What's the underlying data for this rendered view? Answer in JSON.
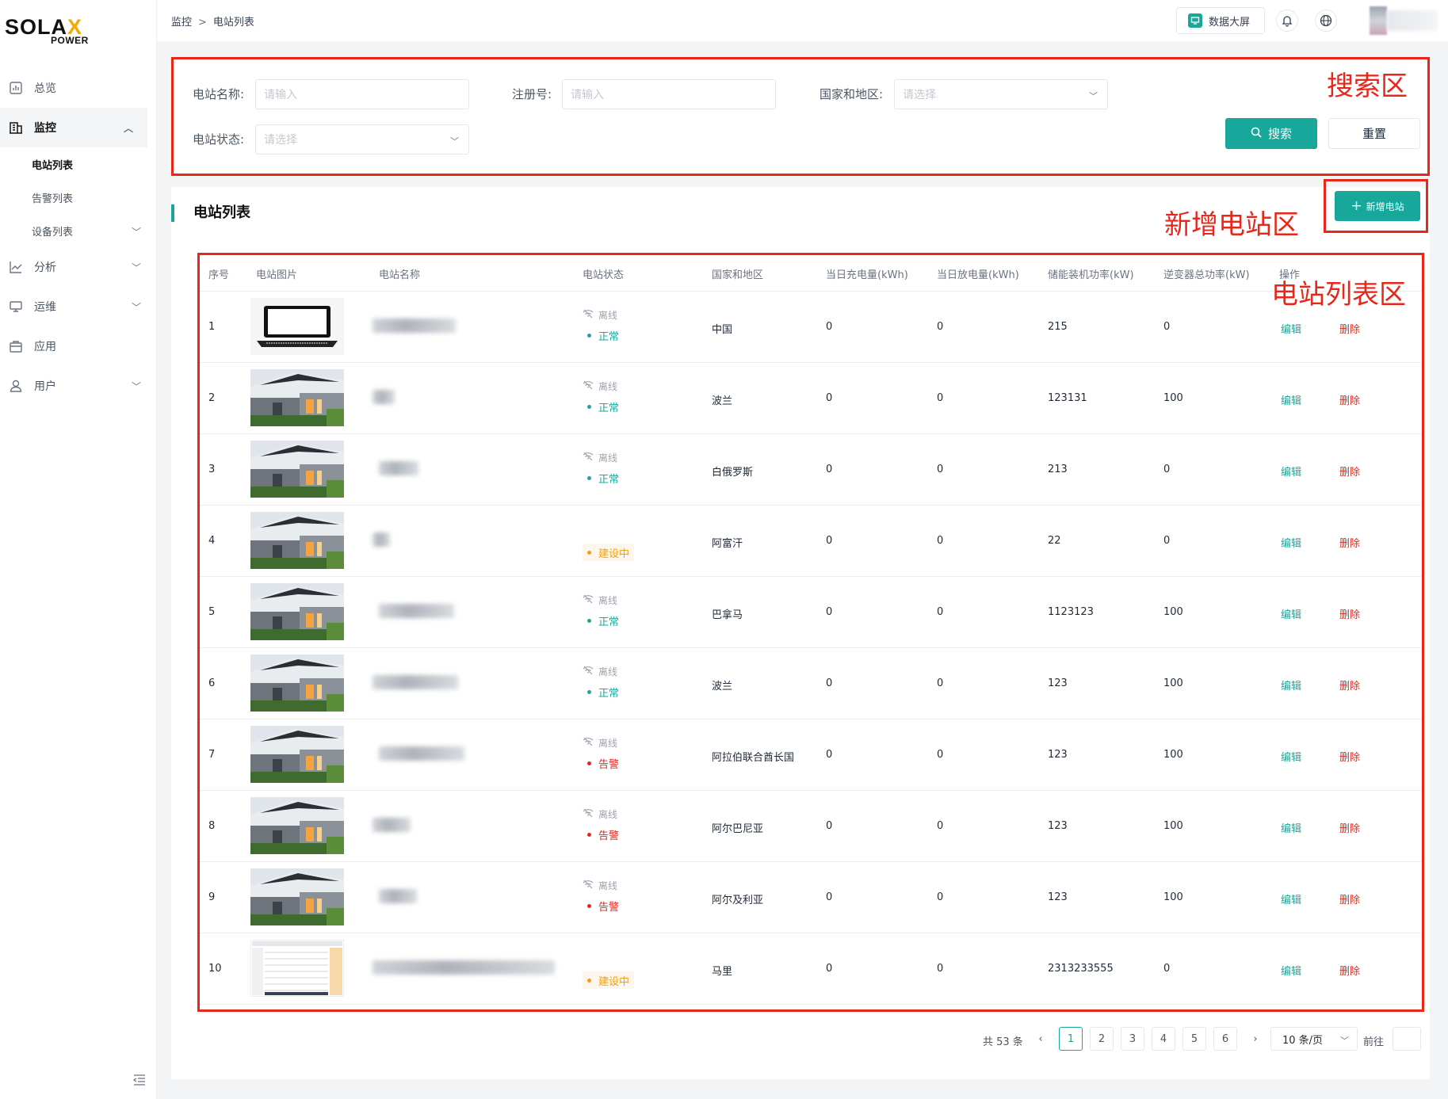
{
  "sidebar": {
    "logo_main": "SOLA",
    "logo_x": "X",
    "logo_sub": "POWER",
    "items": [
      {
        "label": "总览"
      },
      {
        "label": "监控"
      },
      {
        "label": "电站列表"
      },
      {
        "label": "告警列表"
      },
      {
        "label": "设备列表"
      },
      {
        "label": "分析"
      },
      {
        "label": "运维"
      },
      {
        "label": "应用"
      },
      {
        "label": "用户"
      }
    ]
  },
  "header": {
    "breadcrumb": [
      "监控",
      "电站列表"
    ],
    "breadcrumb_sep": ">",
    "bigscreen_label": "数据大屏"
  },
  "search": {
    "station_name_label": "电站名称:",
    "station_name_placeholder": "请输入",
    "reg_no_label": "注册号:",
    "reg_no_placeholder": "请输入",
    "country_label": "国家和地区:",
    "country_placeholder": "请选择",
    "status_label": "电站状态:",
    "status_placeholder": "请选择",
    "search_btn": "搜索",
    "reset_btn": "重置"
  },
  "annotations": {
    "search_zone": "搜索区",
    "add_zone": "新增电站区",
    "list_zone": "电站列表区"
  },
  "list": {
    "title": "电站列表",
    "add_btn": "新增电站",
    "columns": [
      "序号",
      "电站图片",
      "电站名称",
      "电站状态",
      "国家和地区",
      "当日充电量(kWh)",
      "当日放电量(kWh)",
      "储能装机功率(kW)",
      "逆变器总功率(kW)",
      "操作"
    ],
    "offline_label": "离线",
    "edit_label": "编辑",
    "delete_label": "删除",
    "rows": [
      {
        "no": "1",
        "status": "正常",
        "status_type": "ok",
        "offline": true,
        "country": "中国",
        "charge": "0",
        "discharge": "0",
        "storage_power": "215",
        "inverter_power": "0",
        "image": "laptop"
      },
      {
        "no": "2",
        "status": "正常",
        "status_type": "ok",
        "offline": true,
        "country": "波兰",
        "charge": "0",
        "discharge": "0",
        "storage_power": "123131",
        "inverter_power": "100",
        "image": "house"
      },
      {
        "no": "3",
        "status": "正常",
        "status_type": "ok",
        "offline": true,
        "country": "白俄罗斯",
        "charge": "0",
        "discharge": "0",
        "storage_power": "213",
        "inverter_power": "0",
        "image": "house"
      },
      {
        "no": "4",
        "status": "建设中",
        "status_type": "build",
        "offline": false,
        "country": "阿富汗",
        "charge": "0",
        "discharge": "0",
        "storage_power": "22",
        "inverter_power": "0",
        "image": "house"
      },
      {
        "no": "5",
        "status": "正常",
        "status_type": "ok",
        "offline": true,
        "country": "巴拿马",
        "charge": "0",
        "discharge": "0",
        "storage_power": "1123123",
        "inverter_power": "100",
        "image": "house"
      },
      {
        "no": "6",
        "status": "正常",
        "status_type": "ok",
        "offline": true,
        "country": "波兰",
        "charge": "0",
        "discharge": "0",
        "storage_power": "123",
        "inverter_power": "100",
        "image": "house"
      },
      {
        "no": "7",
        "status": "告警",
        "status_type": "alarm",
        "offline": true,
        "country": "阿拉伯联合酋长国",
        "charge": "0",
        "discharge": "0",
        "storage_power": "123",
        "inverter_power": "100",
        "image": "house"
      },
      {
        "no": "8",
        "status": "告警",
        "status_type": "alarm",
        "offline": true,
        "country": "阿尔巴尼亚",
        "charge": "0",
        "discharge": "0",
        "storage_power": "123",
        "inverter_power": "100",
        "image": "house"
      },
      {
        "no": "9",
        "status": "告警",
        "status_type": "alarm",
        "offline": true,
        "country": "阿尔及利亚",
        "charge": "0",
        "discharge": "0",
        "storage_power": "123",
        "inverter_power": "100",
        "image": "house"
      },
      {
        "no": "10",
        "status": "建设中",
        "status_type": "build",
        "offline": false,
        "country": "马里",
        "charge": "0",
        "discharge": "0",
        "storage_power": "2313233555",
        "inverter_power": "0",
        "image": "screenshot"
      }
    ]
  },
  "pagination": {
    "total_text": "共 53 条",
    "pages": [
      "1",
      "2",
      "3",
      "4",
      "5",
      "6"
    ],
    "current": "1",
    "page_size": "10 条/页",
    "goto_label": "前往"
  }
}
